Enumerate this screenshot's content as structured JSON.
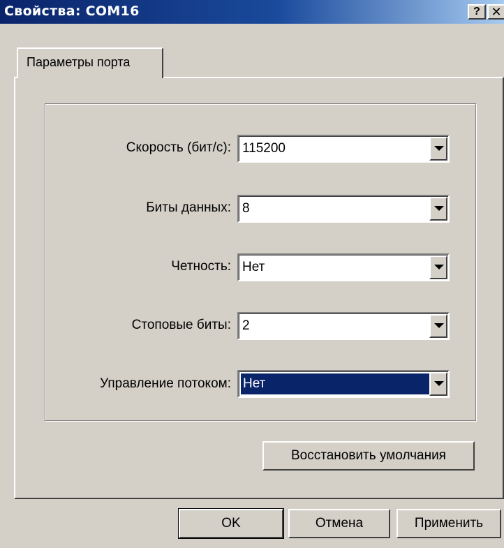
{
  "window": {
    "title": "Свойства: COM16",
    "help_label": "?",
    "close_label": "✕"
  },
  "tabs": [
    {
      "label": "Параметры порта",
      "active": true
    }
  ],
  "settings": {
    "baud_rate": {
      "label": "Скорость (бит/с):",
      "value": "115200"
    },
    "data_bits": {
      "label": "Биты данных:",
      "value": "8"
    },
    "parity": {
      "label": "Четность:",
      "value": "Нет"
    },
    "stop_bits": {
      "label": "Стоповые биты:",
      "value": "2"
    },
    "flow_control": {
      "label": "Управление потоком:",
      "value": "Нет",
      "selected": true
    }
  },
  "restore_defaults_label": "Восстановить умолчания",
  "footer": {
    "ok_label": "OK",
    "cancel_label": "Отмена",
    "apply_label": "Применить"
  },
  "colors": {
    "title_bar_start": "#0a246a",
    "title_bar_end": "#a6caf0",
    "dialog_face": "#d4d0c8",
    "selection_highlight": "#0a246a"
  }
}
